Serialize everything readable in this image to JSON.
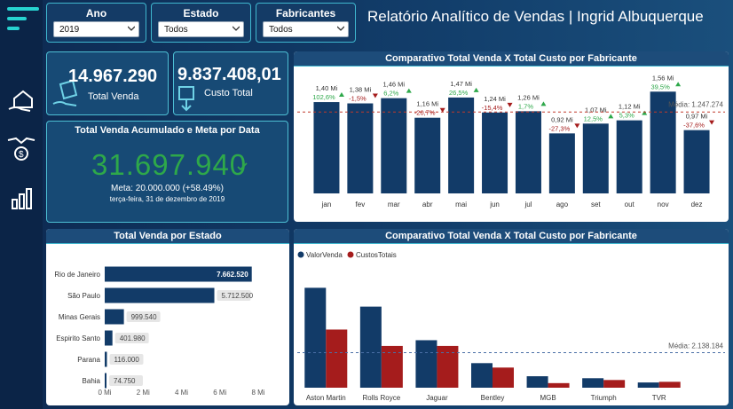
{
  "title": "Relatório Analítico de Vendas | Ingrid Albuquerque",
  "filters": {
    "ano": {
      "label": "Ano",
      "value": "2019"
    },
    "estado": {
      "label": "Estado",
      "value": "Todos"
    },
    "fabricantes": {
      "label": "Fabricantes",
      "value": "Todos"
    }
  },
  "kpis": {
    "total_venda": {
      "value": "14.967.290",
      "label": "Total Venda"
    },
    "custo_total": {
      "value": "9.837.408,01",
      "label": "Custo Total"
    }
  },
  "acumulado": {
    "title": "Total Venda Acumulado e Meta por Data",
    "value": "31.697.940",
    "meta": "Meta: 20.000.000 (+58.49%)",
    "date": "terça-feira, 31 de dezembro de 2019"
  },
  "colors": {
    "navy": "#123b68",
    "red": "#a51c1c",
    "green": "#2ea84a",
    "teal": "#27d3d0"
  },
  "chart_data": [
    {
      "type": "bar",
      "title": "Comparativo Total Venda X Total Custo por Fabricante",
      "categories": [
        "jan",
        "fev",
        "mar",
        "abr",
        "mai",
        "jun",
        "jul",
        "ago",
        "set",
        "out",
        "nov",
        "dez"
      ],
      "values": [
        1.4,
        1.38,
        1.46,
        1.16,
        1.47,
        1.24,
        1.26,
        0.92,
        1.07,
        1.12,
        1.56,
        0.97
      ],
      "value_labels": [
        "1,40 Mi",
        "1,38 Mi",
        "1,46 Mi",
        "1,16 Mi",
        "1,47 Mi",
        "1,24 Mi",
        "1,26 Mi",
        "0,92 Mi",
        "1,07 Mi",
        "1,12 Mi",
        "1,56 Mi",
        "0,97 Mi"
      ],
      "variation_labels": [
        "102,6%",
        "-1,5%",
        "6,2%",
        "-20,7%",
        "26,5%",
        "-15,4%",
        "1,7%",
        "-27,3%",
        "12,5%",
        "5,3%",
        "39,5%",
        "-37,6%"
      ],
      "variation_direction": [
        "up",
        "down",
        "up",
        "down",
        "up",
        "down",
        "up",
        "down",
        "up",
        "up",
        "up",
        "down"
      ],
      "average": 1.247274,
      "average_label": "Média: 1.247.274",
      "ylim": [
        0,
        1.7
      ]
    },
    {
      "type": "bar",
      "orientation": "horizontal",
      "title": "Total Venda por Estado",
      "categories": [
        "Rio de Janeiro",
        "São Paulo",
        "Minas Gerais",
        "Espirito Santo",
        "Parana",
        "Bahia"
      ],
      "values": [
        7662520,
        5712500,
        999540,
        401980,
        116000,
        74750
      ],
      "value_labels": [
        "7.662.520",
        "5.712.500",
        "999.540",
        "401.980",
        "116.000",
        "74.750"
      ],
      "xticks": [
        "0 Mi",
        "2 Mi",
        "4 Mi",
        "6 Mi",
        "8 Mi"
      ],
      "xlim": [
        0,
        8000000
      ]
    },
    {
      "type": "bar",
      "title": "Comparativo Total Venda X Total Custo por Fabricante",
      "categories": [
        "Aston Martin",
        "Rolls Royce",
        "Jaguar",
        "Bentley",
        "MGB",
        "Triumph",
        "TVR"
      ],
      "series": [
        {
          "name": "ValorVenda",
          "values": [
            6100000,
            4950000,
            2900000,
            1500000,
            700000,
            580000,
            320000
          ],
          "color": "#123b68"
        },
        {
          "name": "CustosTotais",
          "values": [
            3550000,
            2550000,
            2550000,
            1230000,
            280000,
            470000,
            360000
          ],
          "color": "#a51c1c"
        }
      ],
      "average": 2138184,
      "average_label": "Média: 2.138.184",
      "ylim": [
        0,
        6500000
      ]
    }
  ]
}
